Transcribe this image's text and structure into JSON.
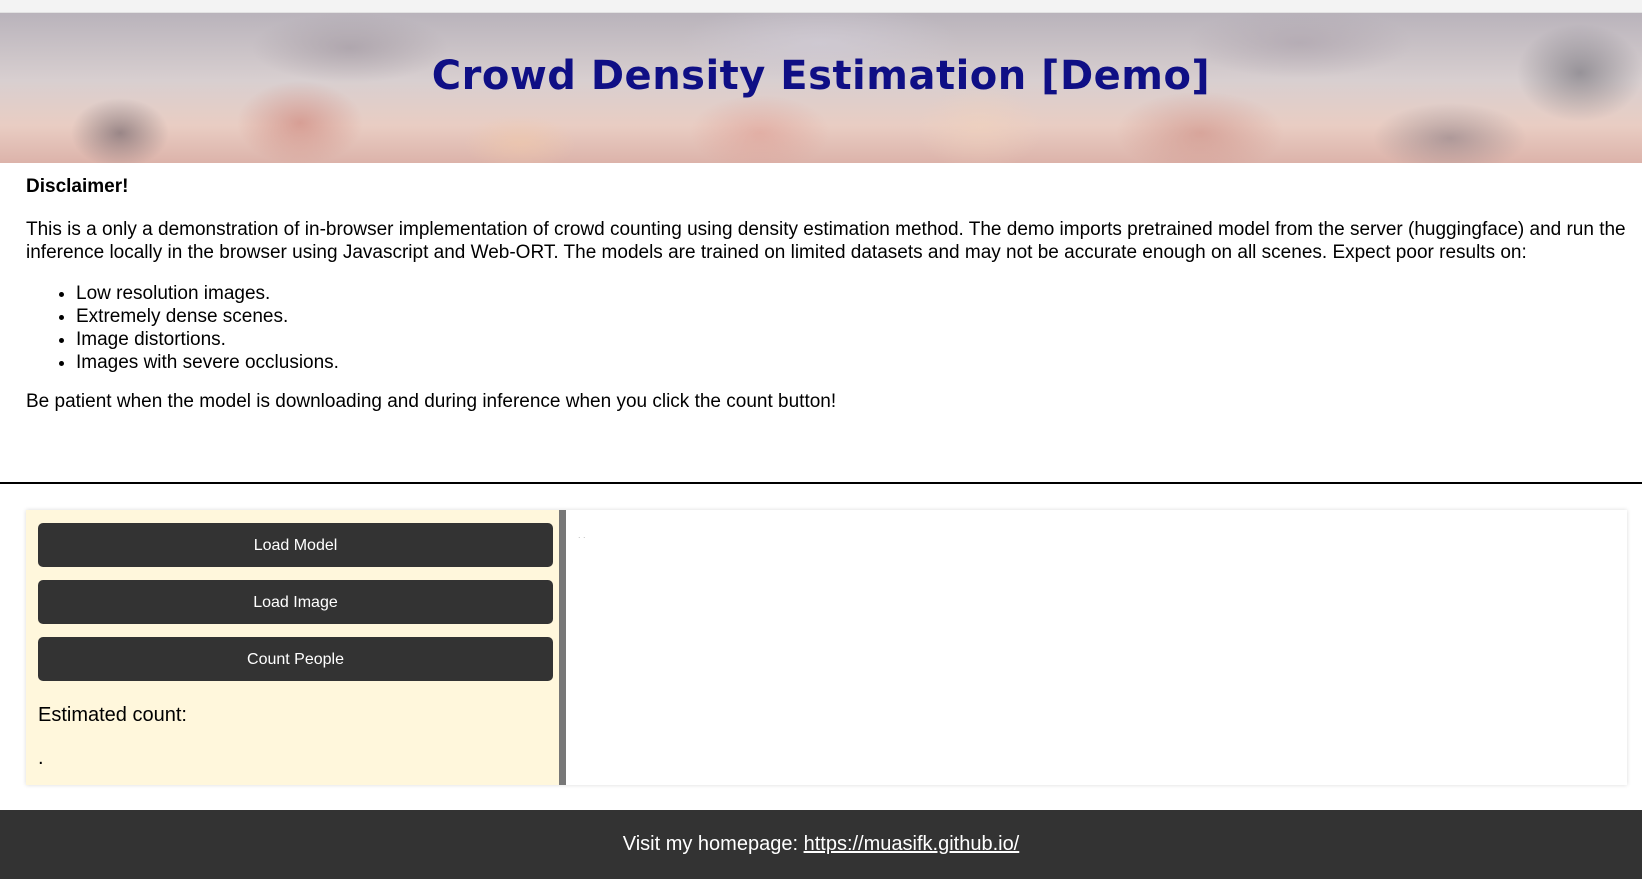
{
  "banner": {
    "title": "Crowd Density Estimation [Demo]"
  },
  "disclaimer": {
    "heading": "Disclaimer!",
    "paragraph": "This is a only a demonstration of in-browser implementation of crowd counting using density estimation method. The demo imports pretrained model from the server (huggingface) and run the inference locally in the browser using Javascript and Web-ORT. The models are trained on limited datasets and may not be accurate enough on all scenes. Expect poor results on:",
    "items": [
      "Low resolution images.",
      "Extremely dense scenes.",
      "Image distortions.",
      "Images with severe occlusions."
    ],
    "note": "Be patient when the model is downloading and during inference when you click the count button!"
  },
  "controls": {
    "load_model_label": "Load Model",
    "load_image_label": "Load Image",
    "count_people_label": "Count People",
    "estimated_count_label": "Estimated count:",
    "estimated_count_value": "."
  },
  "canvas": {
    "placeholder": ". ."
  },
  "footer": {
    "text": "Visit my homepage: ",
    "link_text": "https://muasifk.github.io/"
  },
  "colors": {
    "title": "#0f0f85",
    "button_bg": "#333333",
    "panel_bg": "#fff7dc",
    "footer_bg": "#333333"
  }
}
